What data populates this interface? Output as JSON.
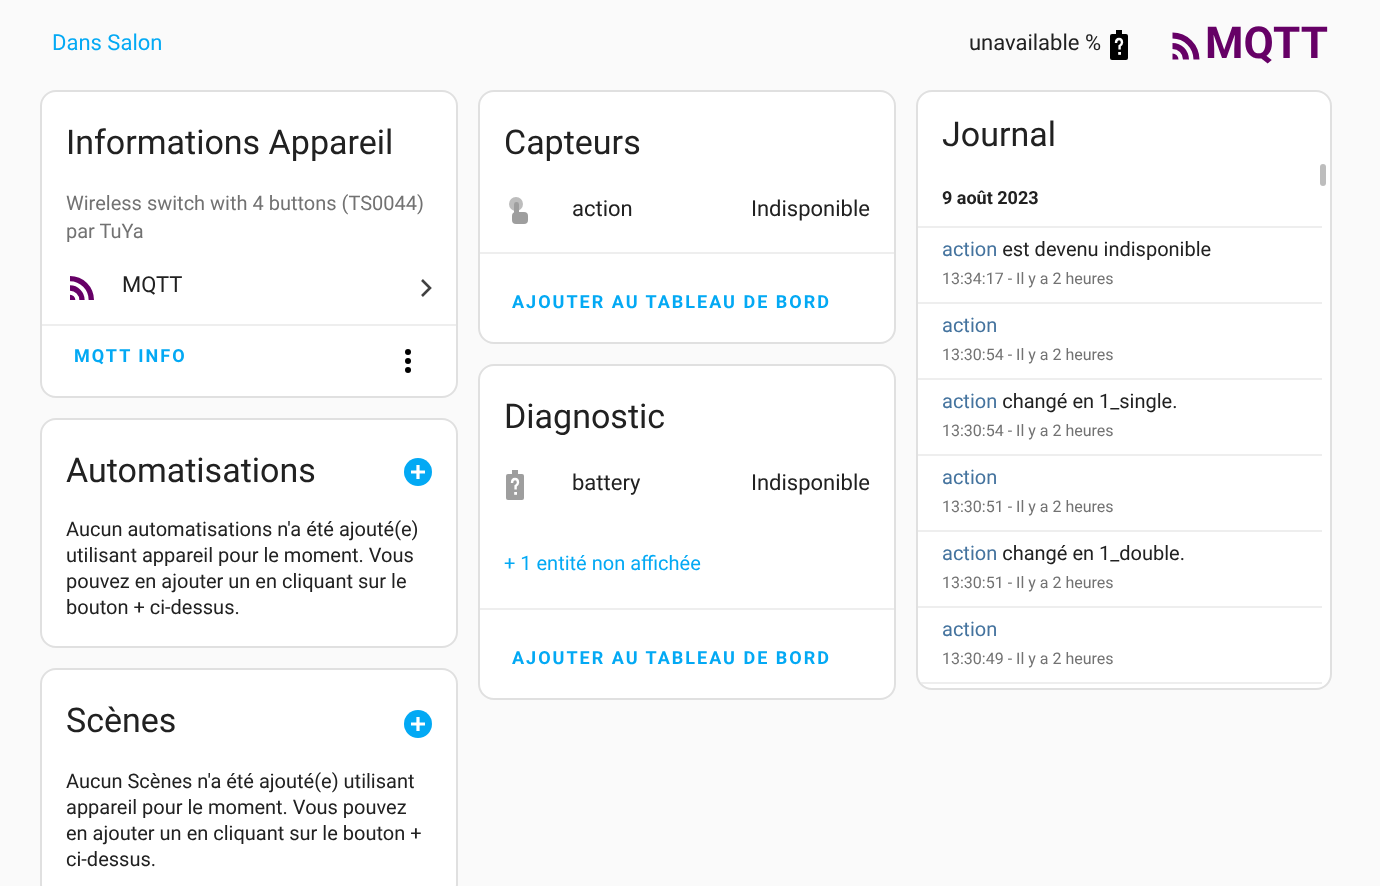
{
  "header": {
    "area_link": "Dans Salon",
    "battery_reading": "unavailable %",
    "logo": "MQTT"
  },
  "device_info": {
    "title": "Informations Appareil",
    "model": "Wireless switch with 4 buttons (TS0044)",
    "manufacturer": "par TuYa",
    "integration": "MQTT",
    "action": "MQTT INFO"
  },
  "automations": {
    "title": "Automatisations",
    "text": "Aucun automatisations n'a été ajouté(e) utilisant appareil pour le moment. Vous pouvez en ajouter un en cliquant sur le bouton + ci-dessus."
  },
  "scenes": {
    "title": "Scènes",
    "text": "Aucun Scènes n'a été ajouté(e) utilisant appareil pour le moment. Vous pouvez en ajouter un en cliquant sur le bouton + ci-dessus."
  },
  "sensors": {
    "title": "Capteurs",
    "entities": [
      {
        "kind": "touch",
        "name": "action",
        "state": "Indisponible"
      }
    ],
    "action": "AJOUTER AU TABLEAU DE BORD"
  },
  "diagnostic": {
    "title": "Diagnostic",
    "entities": [
      {
        "kind": "battery",
        "name": "battery",
        "state": "Indisponible"
      }
    ],
    "hidden_link": "+ 1 entité non affichée",
    "action": "AJOUTER AU TABLEAU DE BORD"
  },
  "logbook": {
    "title": "Journal",
    "date": "9 août 2023",
    "entries": [
      {
        "entity": "action",
        "message": "est devenu indisponible",
        "time": "13:34:17 - Il y a 2 heures"
      },
      {
        "entity": "action",
        "time": "13:30:54 - Il y a 2 heures"
      },
      {
        "entity": "action",
        "message": "changé en 1_single.",
        "time": "13:30:54 - Il y a 2 heures"
      },
      {
        "entity": "action",
        "time": "13:30:51 - Il y a 2 heures"
      },
      {
        "entity": "action",
        "message": "changé en 1_double.",
        "time": "13:30:51 - Il y a 2 heures"
      },
      {
        "entity": "action",
        "time": "13:30:49 - Il y a 2 heures"
      }
    ]
  }
}
